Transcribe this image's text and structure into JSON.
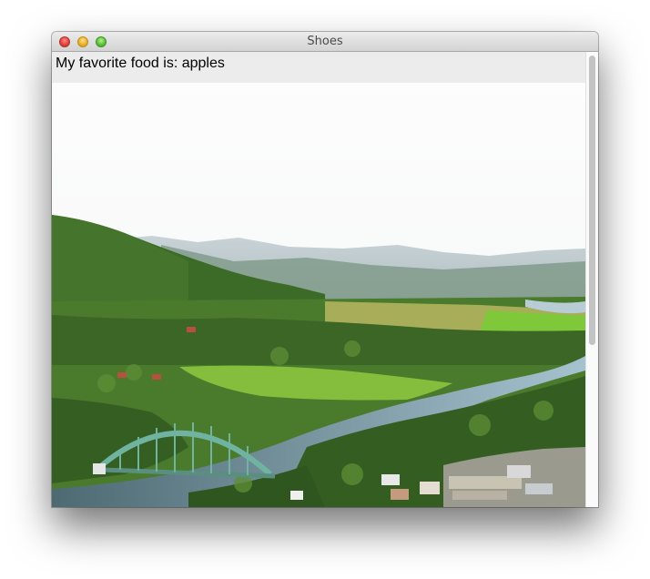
{
  "window": {
    "title": "Shoes"
  },
  "content": {
    "text": "My favorite food is: apples"
  },
  "image": {
    "subject": "landscape-photo"
  },
  "colors": {
    "titlebar": "#d8d8d8",
    "sky": "#fbfbfb",
    "forest": "#3f6a2a",
    "field": "#8ec23e",
    "river": "#6f8f9a",
    "bridge": "#5fae9a"
  }
}
